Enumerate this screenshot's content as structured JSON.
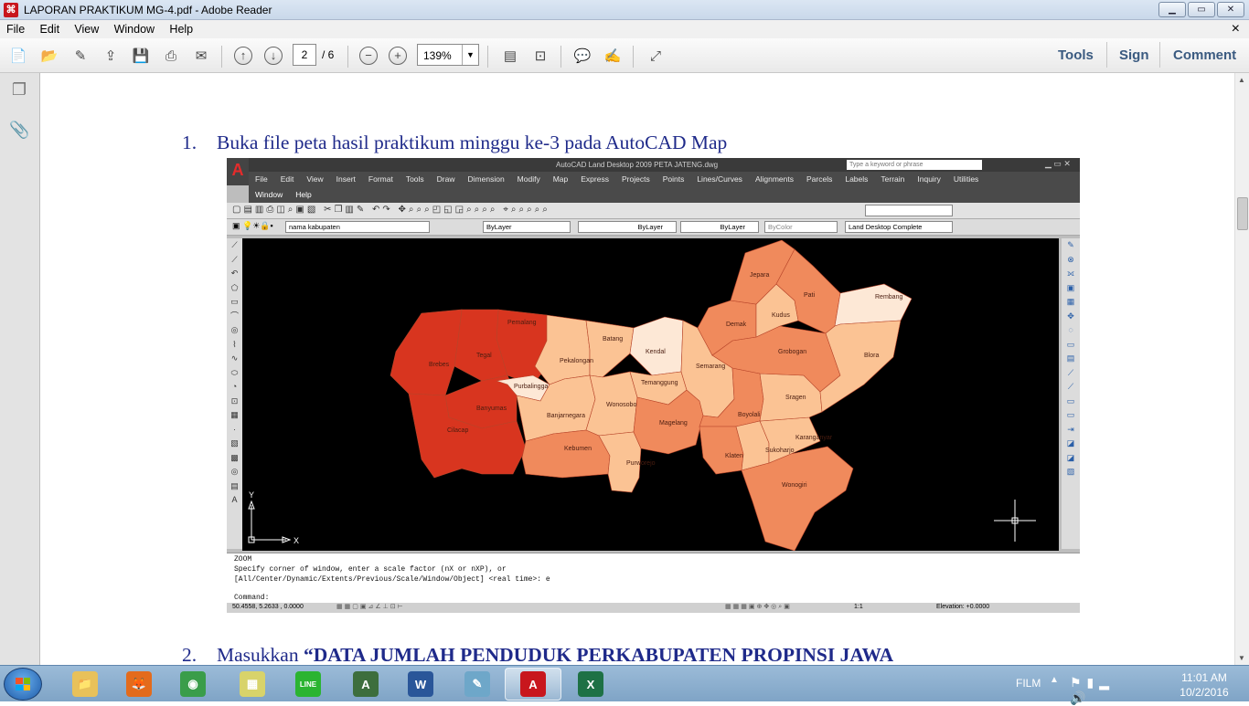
{
  "window": {
    "title": "LAPORAN PRAKTIKUM MG-4.pdf - Adobe Reader",
    "controls": [
      "minimize",
      "maximize",
      "close"
    ],
    "close_glyph": "✕"
  },
  "menu": [
    "File",
    "Edit",
    "View",
    "Window",
    "Help"
  ],
  "menu_close_glyph": "×",
  "toolbar": {
    "page_current": "2",
    "page_total": "/ 6",
    "zoom": "139%",
    "links": [
      "Tools",
      "Sign",
      "Comment"
    ]
  },
  "document": {
    "step1_num": "1.",
    "step1_text": "Buka file peta hasil praktikum minggu ke-3 pada AutoCAD Map",
    "step2_num": "2.",
    "step2_prefix": "Masukkan ",
    "step2_bold": "“DATA JUMLAH PENDUDUK PERKABUPATEN PROPINSI JAWA"
  },
  "autocad": {
    "title": "AutoCAD Land Desktop 2009  PETA JATENG.dwg",
    "search_placeholder": "Type a keyword or phrase",
    "menu1": [
      "File",
      "Edit",
      "View",
      "Insert",
      "Format",
      "Tools",
      "Draw",
      "Dimension",
      "Modify",
      "Map",
      "Express",
      "Projects",
      "Points",
      "Lines/Curves",
      "Alignments",
      "Parcels",
      "Labels",
      "Terrain",
      "Inquiry",
      "Utilities"
    ],
    "menu2": [
      "Window",
      "Help"
    ],
    "layer": "nama kabupaten",
    "color": "ByLayer",
    "linetype": "ByLayer",
    "lineweight": "ByLayer",
    "plotstyle": "ByColor",
    "workspace": "Land Desktop Complete",
    "axis_y": "Y",
    "axis_x": "X",
    "cmd_lines": [
      "ZOOM",
      "Specify corner of window, enter a scale factor (nX or nXP), or",
      "[All/Center/Dynamic/Extents/Previous/Scale/Window/Object] <real time>: e"
    ],
    "cmd_prompt": "Command:",
    "coords": "50.4558, 5.2633 , 0.0000",
    "scale": "1:1",
    "elevation": "Elevation: +0.0000",
    "colors": {
      "c1": "#d8351f",
      "c2": "#f08a5c",
      "c3": "#fbc394",
      "c4": "#fde8d6"
    },
    "regions": [
      {
        "name": "Pemalang",
        "c": "c1"
      },
      {
        "name": "Tegal",
        "c": "c1"
      },
      {
        "name": "Brebes",
        "c": "c1"
      },
      {
        "name": "Banyumas",
        "c": "c1"
      },
      {
        "name": "Cilacap",
        "c": "c1"
      },
      {
        "name": "Purbalingga",
        "c": "c4"
      },
      {
        "name": "Pekalongan",
        "c": "c3"
      },
      {
        "name": "Batang",
        "c": "c3"
      },
      {
        "name": "Kendal",
        "c": "c4"
      },
      {
        "name": "Banjarnegara",
        "c": "c3"
      },
      {
        "name": "Wonosobo",
        "c": "c3"
      },
      {
        "name": "Temanggung",
        "c": "c3"
      },
      {
        "name": "Kebumen",
        "c": "c2"
      },
      {
        "name": "Purworejo",
        "c": "c3"
      },
      {
        "name": "Magelang",
        "c": "c2"
      },
      {
        "name": "Semarang",
        "c": "c3"
      },
      {
        "name": "Boyolali",
        "c": "c2"
      },
      {
        "name": "Klaten",
        "c": "c2"
      },
      {
        "name": "Sukoharjo",
        "c": "c3"
      },
      {
        "name": "Wonogiri",
        "c": "c2"
      },
      {
        "name": "Karanganyar",
        "c": "c3"
      },
      {
        "name": "Sragen",
        "c": "c3"
      },
      {
        "name": "Grobogan",
        "c": "c2"
      },
      {
        "name": "Demak",
        "c": "c2"
      },
      {
        "name": "Kudus",
        "c": "c3"
      },
      {
        "name": "Jepara",
        "c": "c2"
      },
      {
        "name": "Pati",
        "c": "c2"
      },
      {
        "name": "Rembang",
        "c": "c4"
      },
      {
        "name": "Blora",
        "c": "c3"
      }
    ]
  },
  "taskbar": {
    "apps": [
      {
        "name": "explorer-icon",
        "label": "📁",
        "color": "#e8c15a"
      },
      {
        "name": "firefox-icon",
        "label": "🦊",
        "color": "#e36b1c"
      },
      {
        "name": "chrome-icon",
        "label": "◉",
        "color": "#3a9d4a"
      },
      {
        "name": "sticky-notes-icon",
        "label": "▦",
        "color": "#d8d36a"
      },
      {
        "name": "line-icon",
        "label": "LINE",
        "color": "#2bb431"
      },
      {
        "name": "autocad-icon",
        "label": "A",
        "color": "#3d6e3d"
      },
      {
        "name": "word-icon",
        "label": "W",
        "color": "#2a5699"
      },
      {
        "name": "notepad-icon",
        "label": "✎",
        "color": "#6ea7c9"
      },
      {
        "name": "acrobat-icon",
        "label": "A",
        "color": "#c8161d"
      },
      {
        "name": "excel-icon",
        "label": "X",
        "color": "#1e7145"
      }
    ],
    "tray_label": "FILM",
    "time": "11:01 AM",
    "date": "10/2/2016"
  }
}
